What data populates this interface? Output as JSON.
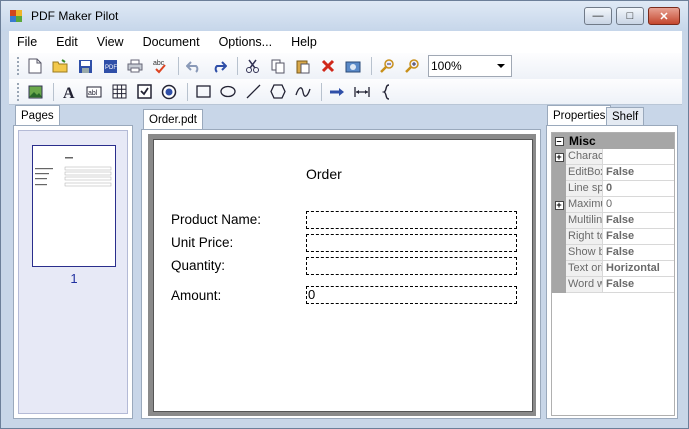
{
  "window": {
    "title": "PDF Maker Pilot"
  },
  "menu": [
    "File",
    "Edit",
    "View",
    "Document",
    "Options...",
    "Help"
  ],
  "toolbar": {
    "zoom_value": "100%"
  },
  "tabs": {
    "pages": "Pages",
    "document": "Order.pdt",
    "properties": "Properties",
    "shelf": "Shelf"
  },
  "pages_panel": {
    "page_number": "1"
  },
  "form": {
    "title": "Order",
    "labels": [
      "Product Name:",
      "Unit Price:",
      "Quantity:",
      "Amount:"
    ],
    "amount_value": "0"
  },
  "properties": {
    "category": "Misc",
    "rows": [
      {
        "name": "Characters",
        "value": "",
        "expandable": true
      },
      {
        "name": "EditBox",
        "value": "False"
      },
      {
        "name": "Line spacing",
        "value": "0"
      },
      {
        "name": "Maximum",
        "value": "0",
        "expandable": true
      },
      {
        "name": "Multiline",
        "value": "False"
      },
      {
        "name": "Right to left",
        "value": "False"
      },
      {
        "name": "Show border",
        "value": "False"
      },
      {
        "name": "Text orientation",
        "value": "Horizontal"
      },
      {
        "name": "Word wrap",
        "value": "False"
      }
    ]
  }
}
